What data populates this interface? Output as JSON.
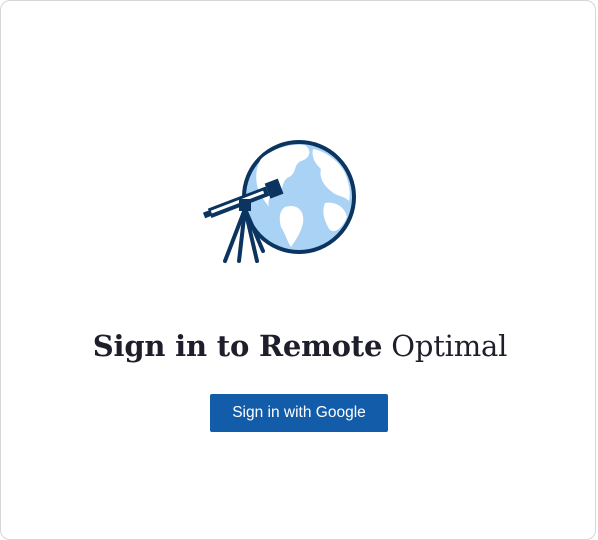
{
  "login": {
    "title_bold": "Sign in to Remote",
    "title_light": "Optimal",
    "google_button_label": "Sign in with Google"
  },
  "colors": {
    "navy": "#0b3560",
    "globe_fill": "#a9d2f5",
    "button": "#135ca9",
    "title": "#1f1f2b"
  },
  "icons": {
    "logo": "telescope-globe-icon"
  }
}
